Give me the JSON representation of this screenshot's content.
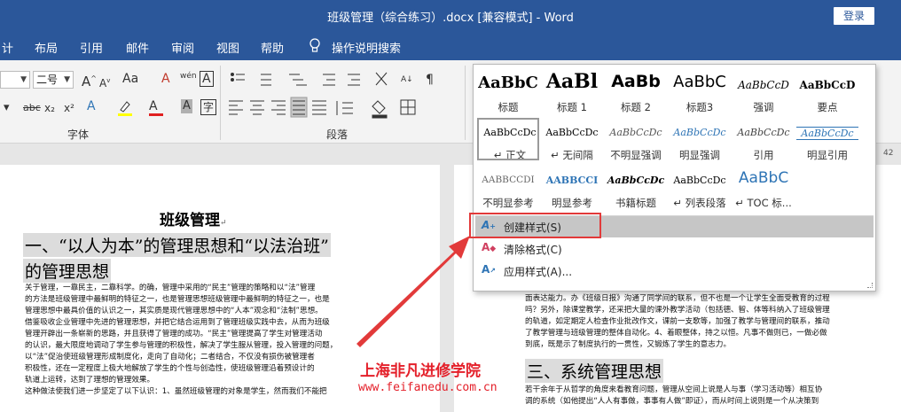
{
  "window": {
    "title": "班级管理（综合练习）.docx [兼容模式]  -  Word",
    "login": "登录"
  },
  "menu": {
    "items": [
      "计",
      "布局",
      "引用",
      "邮件",
      "审阅",
      "视图",
      "帮助"
    ],
    "search": "操作说明搜索"
  },
  "ribbon": {
    "font_size": "二号",
    "font_group": "字体",
    "paragraph_group": "段落",
    "font_icons": [
      "Aa",
      "A",
      "wén",
      "A",
      "abc",
      "x₂",
      "x²",
      "A",
      "A",
      "A"
    ]
  },
  "ruler": {
    "numbers": [
      "32",
      "34",
      "36",
      "38",
      "40",
      "42"
    ]
  },
  "gallery": {
    "styles": [
      {
        "preview": "AaBbC",
        "name": "标题"
      },
      {
        "preview": "AaBl",
        "name": "标题 1"
      },
      {
        "preview": "AaBb",
        "name": "标题 2"
      },
      {
        "preview": "AaBbC",
        "name": "标题3"
      },
      {
        "preview": "AaBbCcD",
        "name": "强调"
      },
      {
        "preview": "AaBbCcD",
        "name": "要点"
      },
      {
        "preview": "AaBbCcDc",
        "name": "↵ 正文"
      },
      {
        "preview": "AaBbCcDc",
        "name": "↵ 无间隔"
      },
      {
        "preview": "AaBbCcDc",
        "name": "不明显强调"
      },
      {
        "preview": "AaBbCcDc",
        "name": "明显强调"
      },
      {
        "preview": "AaBbCcDc",
        "name": "引用"
      },
      {
        "preview": "AaBbCcDc",
        "name": "明显引用"
      },
      {
        "preview": "AABBCCDI",
        "name": "不明显参考"
      },
      {
        "preview": "AABBCCI",
        "name": "明显参考"
      },
      {
        "preview": "AaBbCcDc",
        "name": "书籍标题"
      },
      {
        "preview": "AaBbCcDc",
        "name": "↵ 列表段落"
      },
      {
        "preview": "AaBbC",
        "name": "↵ TOC 标..."
      }
    ],
    "create_style": "创建样式(S)",
    "clear_format": "清除格式(C)",
    "apply_style": "应用样式(A)..."
  },
  "doc_left": {
    "title": "班级管理",
    "heading1_line1": "一、“以人为本”的管理思想和“以法治班”",
    "heading1_line2": "的管理思想",
    "body": [
      "关于管理，一靠民主，二靠科学。的确，管理中采用的“民主”管理的策略和以“法”管理",
      "的方法是班级管理中最鲜明的特征之一，也是管理思想班级管理中最鲜明的特征之一，也是",
      "管理思想中最具价值的认识之一，其实质是现代管理思想中的“人本”观念和“法制”思想。",
      "借鉴吸收企业管理中先进的管理思想，并把它结合运用到了管理班级实践中去，从而为班级",
      "管理开辟出一条崭新的思路，并且获得了管理的成功。“民主”管理提高了学生对管理活动",
      "的认识，最大限度地调动了学生参与管理的积极性，解决了学生服从管理，投入管理的问题，",
      "以“法”促治使班级管理形成制度化，走向了自动化；二者结合，不仅没有损伤被管理者",
      "积极性，还在一定程度上极大地解放了学生的个性与创造性，使班级管理沿着预设计的",
      "轨道上运转，达到了理想的管理效果。",
      "这种做法使我们进一步坚定了以下认识：1、虽然班级管理的对象是学生，然而我们不能把"
    ]
  },
  "doc_right": {
    "body_top": [
      "面表达能力。办《班级日报》沟通了同学间的联系，但不也是一个让学生全面受教育的过程",
      "吗？另外，除课堂教学，还采把大量的课外教学活动（包括德、智、体等科纳入了班级管理",
      "的轨道，如定期定人检查作业批改作文，课前一支歌等，加强了教学与管理间的联系，推动",
      "了教学管理与班级管理的整体自动化。4、着眼整体，持之以恒。凡事不做则已，一做必做",
      "到底，既是示了制度执行的一贯性，又锻炼了学生的意志力。"
    ],
    "heading": "三、系统管理思想",
    "body_bottom": [
      "若干余年于从哲学的角度来看教育问题，管理从空间上说是人与事（学习活动等）相互协",
      "调的系统（如他提出“人人有事做，事事有人做”即证），而从时间上说则是一个从决策到"
    ]
  },
  "watermark": {
    "line1": "上海非凡进修学院",
    "line2": "www.feifanedu.com.cn"
  },
  "colors": {
    "titlebar": "#2b579a",
    "accent_red": "#e23a3a",
    "heading_blue": "#2e74b5"
  }
}
